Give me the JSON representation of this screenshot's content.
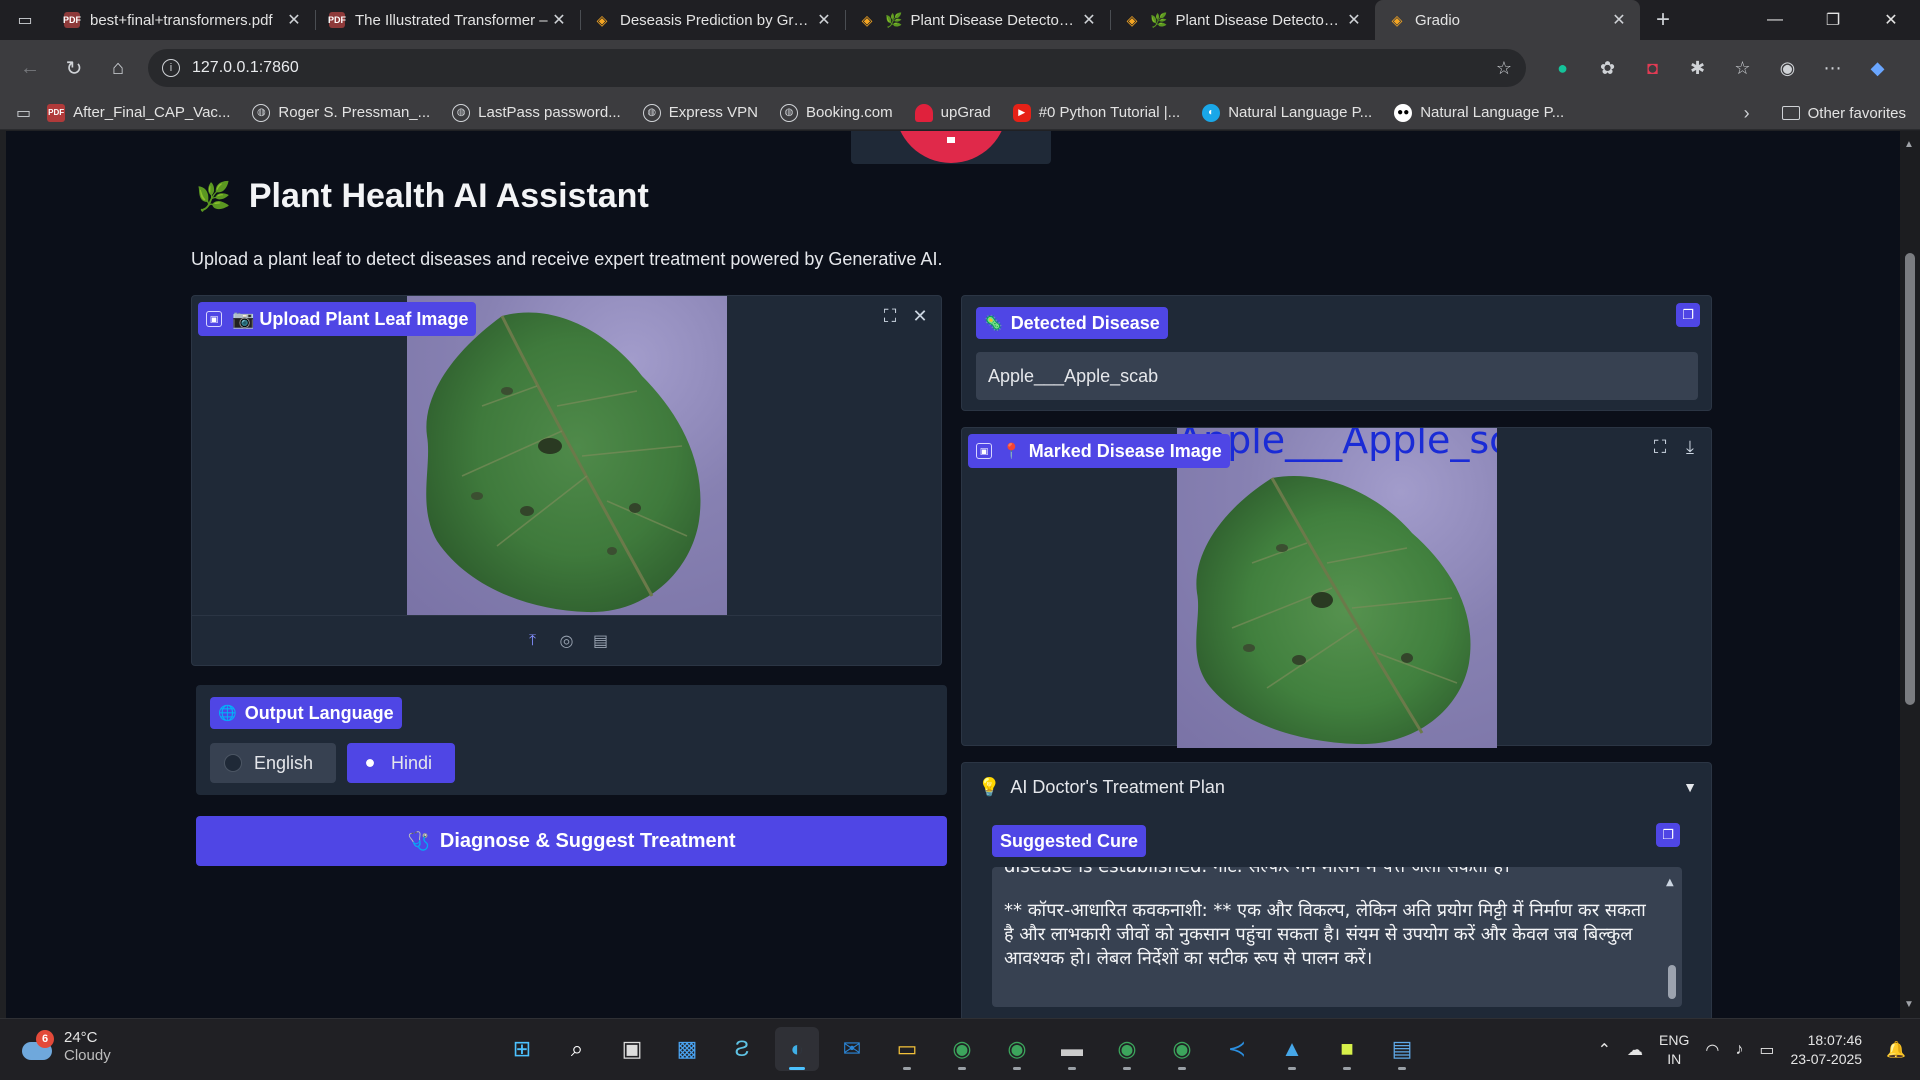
{
  "browser": {
    "tabs": [
      {
        "title": "best+final+transformers.pdf",
        "icon": "pdf-icon",
        "active": false
      },
      {
        "title": "The Illustrated Transformer –",
        "icon": "pdf-icon",
        "active": false
      },
      {
        "title": "Deseasis Prediction by Gradi",
        "icon": "huggingface-icon",
        "active": false
      },
      {
        "title": "Plant Disease Detector w",
        "icon": "plant-icon",
        "active": false
      },
      {
        "title": "Plant Disease Detector w",
        "icon": "plant-icon",
        "active": false
      },
      {
        "title": "Gradio",
        "icon": "gradio-icon",
        "active": true
      }
    ],
    "url": "127.0.0.1:7860",
    "bookmarks": [
      {
        "label": "After_Final_CAP_Vac...",
        "icon": "pdf-icon"
      },
      {
        "label": "Roger S. Pressman_...",
        "icon": "globe-icon"
      },
      {
        "label": "LastPass password...",
        "icon": "globe-icon"
      },
      {
        "label": "Express VPN",
        "icon": "globe-icon"
      },
      {
        "label": "Booking.com",
        "icon": "globe-icon"
      },
      {
        "label": "upGrad",
        "icon": "upgrad-icon"
      },
      {
        "label": "#0 Python Tutorial |...",
        "icon": "youtube-icon"
      },
      {
        "label": "Natural Language P...",
        "icon": "nlp-icon"
      },
      {
        "label": "Natural Language P...",
        "icon": "medium-icon"
      }
    ],
    "other_favorites": "Other favorites"
  },
  "app": {
    "title": "Plant Health AI Assistant",
    "subtitle": "Upload a plant leaf to detect diseases and receive expert treatment powered by Generative AI.",
    "upload": {
      "label": "📷 Upload Plant Leaf Image"
    },
    "language": {
      "label": "Output Language",
      "options": [
        "English",
        "Hindi"
      ],
      "selected": "Hindi"
    },
    "submit_label": "Diagnose & Suggest Treatment",
    "detected": {
      "label": "Detected Disease",
      "value": "Apple___Apple_scab"
    },
    "marked": {
      "label": "Marked Disease Image",
      "overlay_text": "Apple___Apple_scab"
    },
    "treatment": {
      "accordion_label": "AI Doctor's Treatment Plan",
      "cure_label": "Suggested Cure",
      "cure_cut_line": "disease is established. नोट: सल्फर गर्म मौसम में पत्ते जला सकता है।",
      "cure_paragraph": "** कॉपर-आधारित कवकनाशी: ** एक और विकल्प, लेकिन अति प्रयोग मिट्टी में निर्माण कर सकता है और लाभकारी जीवों को नुकसान पहुंचा सकता है। संयम से उपयोग करें और केवल जब बिल्कुल आवश्यक हो।  लेबल निर्देशों का सटीक रूप से पालन करें।"
    }
  },
  "taskbar": {
    "weather_badge": "6",
    "temperature": "24°C",
    "condition": "Cloudy",
    "lang_line1": "ENG",
    "lang_line2": "IN",
    "time": "18:07:46",
    "date": "23-07-2025"
  },
  "colors": {
    "accent": "#4f46e5",
    "page_bg": "#0b0f19",
    "panel_bg": "#1f2937",
    "input_bg": "#374151"
  }
}
